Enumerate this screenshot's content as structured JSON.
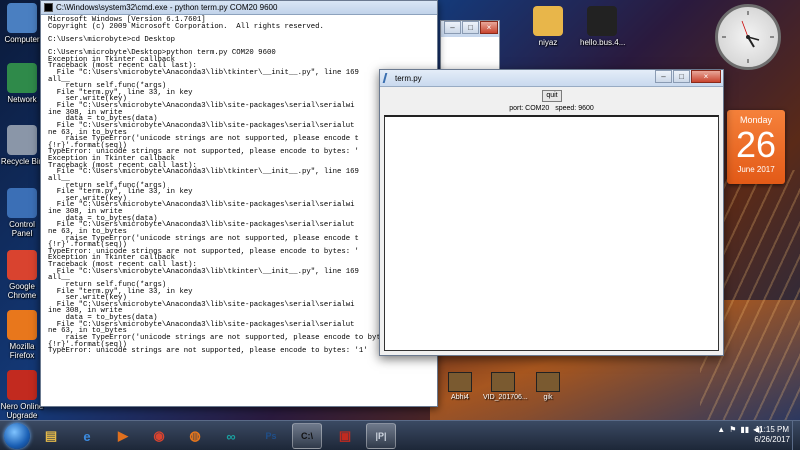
{
  "desktop": {
    "left_icons": [
      {
        "label": "Computer",
        "icon": "computer-icon",
        "color": "#4a7fc1"
      },
      {
        "label": "Network",
        "icon": "network-icon",
        "color": "#2f8a4a"
      },
      {
        "label": "Recycle Bin",
        "icon": "recycle-bin-icon",
        "color": "#8a96a8"
      },
      {
        "label": "Control Panel",
        "icon": "control-panel-icon",
        "color": "#3b6fb6"
      },
      {
        "label": "Google Chrome",
        "icon": "chrome-icon",
        "color": "#d9432f"
      },
      {
        "label": "Mozilla Firefox",
        "icon": "firefox-icon",
        "color": "#e8771c"
      },
      {
        "label": "Nero Online Upgrade",
        "icon": "nero-icon",
        "color": "#c22a1f"
      }
    ],
    "top_icons": [
      {
        "label": "niyaz",
        "icon": "folder-icon",
        "color": "#e8b64a"
      },
      {
        "label": "hello.bus.4...",
        "icon": "file-icon",
        "color": "#222222"
      }
    ],
    "bottom_icons": [
      {
        "label": "Abhi4",
        "icon": "video-thumb-icon"
      },
      {
        "label": "VID_201706...",
        "icon": "video-thumb-icon"
      },
      {
        "label": "gik",
        "icon": "video-thumb-icon"
      }
    ]
  },
  "calendar": {
    "day": "Monday",
    "date": "26",
    "month": "June 2017"
  },
  "cmd": {
    "title": "C:\\Windows\\system32\\cmd.exe - python  term.py COM20 9600",
    "lines": [
      "Microsoft Windows [Version 6.1.7601]",
      "Copyright (c) 2009 Microsoft Corporation.  All rights reserved.",
      "",
      "C:\\Users\\microbyte>cd Desktop",
      "",
      "C:\\Users\\microbyte\\Desktop>python term.py COM20 9600",
      "Exception in Tkinter callback",
      "Traceback (most recent call last):",
      "  File \"C:\\Users\\microbyte\\Anaconda3\\lib\\tkinter\\__init__.py\", line 169",
      "all__",
      "    return self.func(*args)",
      "  File \"term.py\", line 33, in key",
      "    ser.write(key)",
      "  File \"C:\\Users\\microbyte\\Anaconda3\\lib\\site-packages\\serial\\serialwi",
      "ine 308, in write",
      "    data = to_bytes(data)",
      "  File \"C:\\Users\\microbyte\\Anaconda3\\lib\\site-packages\\serial\\serialut",
      "ne 63, in to_bytes",
      "    raise TypeError('unicode strings are not supported, please encode t",
      "{!r}'.format(seq))",
      "TypeError: unicode strings are not supported, please encode to bytes: '",
      "Exception in Tkinter callback",
      "Traceback (most recent call last):",
      "  File \"C:\\Users\\microbyte\\Anaconda3\\lib\\tkinter\\__init__.py\", line 169",
      "all__",
      "    return self.func(*args)",
      "  File \"term.py\", line 33, in key",
      "    ser.write(key)",
      "  File \"C:\\Users\\microbyte\\Anaconda3\\lib\\site-packages\\serial\\serialwi",
      "ine 308, in write",
      "    data = to_bytes(data)",
      "  File \"C:\\Users\\microbyte\\Anaconda3\\lib\\site-packages\\serial\\serialut",
      "ne 63, in to_bytes",
      "    raise TypeError('unicode strings are not supported, please encode t",
      "{!r}'.format(seq))",
      "TypeError: unicode strings are not supported, please encode to bytes: '",
      "Exception in Tkinter callback",
      "Traceback (most recent call last):",
      "  File \"C:\\Users\\microbyte\\Anaconda3\\lib\\tkinter\\__init__.py\", line 169",
      "all__",
      "    return self.func(*args)",
      "  File \"term.py\", line 33, in key",
      "    ser.write(key)",
      "  File \"C:\\Users\\microbyte\\Anaconda3\\lib\\site-packages\\serial\\serialwi",
      "ine 308, in write",
      "    data = to_bytes(data)",
      "  File \"C:\\Users\\microbyte\\Anaconda3\\lib\\site-packages\\serial\\serialut",
      "ne 63, in to_bytes",
      "    raise TypeError('unicode strings are not supported, please encode to bytes:",
      "{!r}'.format(seq))",
      "TypeError: unicode strings are not supported, please encode to bytes: '1'"
    ]
  },
  "term": {
    "title": "term.py",
    "quit_label": "quit",
    "port_text": "port: COM20",
    "speed_text": "speed: 9600",
    "text_area": ""
  },
  "taskbar": {
    "apps": [
      {
        "icon": "explorer-icon",
        "glyph": "▤",
        "color": "#e2b84a",
        "active": false
      },
      {
        "icon": "ie-icon",
        "glyph": "e",
        "color": "#3b8be0",
        "active": false
      },
      {
        "icon": "media-player-icon",
        "glyph": "▶",
        "color": "#e0701e",
        "active": false
      },
      {
        "icon": "chrome-icon",
        "glyph": "◉",
        "color": "#d9432f",
        "active": false
      },
      {
        "icon": "firefox-icon",
        "glyph": "◍",
        "color": "#e8771c",
        "active": false
      },
      {
        "icon": "arduino-icon",
        "glyph": "∞",
        "color": "#1aa0a0",
        "active": false
      },
      {
        "icon": "photoshop-icon",
        "glyph": "Ps",
        "color": "#1f4f8a",
        "active": false
      },
      {
        "icon": "cmd-icon",
        "glyph": "C:\\",
        "color": "#111111",
        "active": true
      },
      {
        "icon": "toolbox-icon",
        "glyph": "▣",
        "color": "#c22a1f",
        "active": false
      },
      {
        "icon": "python-tk-icon",
        "glyph": "|P|",
        "color": "#cfd6e0",
        "active": true
      }
    ],
    "time": "11:15 PM",
    "date": "6/26/2017"
  }
}
